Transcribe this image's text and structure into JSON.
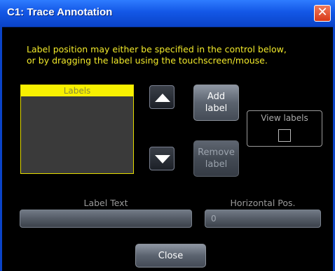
{
  "window": {
    "title": "C1: Trace Annotation",
    "close_glyph": "✕"
  },
  "instructions": [
    "Label position may either be specified in the control below,",
    "or by dragging the label using the touchscreen/mouse."
  ],
  "labels_list": {
    "header": "Labels",
    "items": []
  },
  "buttons": {
    "up_icon": "triangle-up-icon",
    "down_icon": "triangle-down-icon",
    "add_label": [
      "Add",
      "label"
    ],
    "remove_label": [
      "Remove",
      "label"
    ],
    "close": "Close"
  },
  "view_labels": {
    "label": "View labels",
    "checked": false
  },
  "label_text": {
    "label": "Label Text",
    "value": ""
  },
  "horizontal_pos": {
    "label": "Horizontal Pos.",
    "value": "0"
  },
  "colors": {
    "title_bar": "#0a43c8",
    "instruction_text": "#f2ea2a",
    "labels_header_bg": "#f7f000",
    "close_button": "#d83a18"
  }
}
